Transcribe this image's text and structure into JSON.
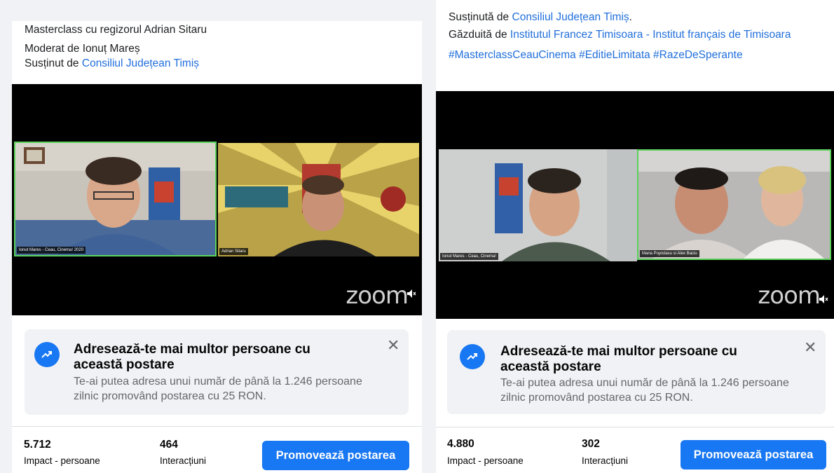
{
  "left": {
    "title_line": "Masterclass cu regizorul Adrian Sitaru",
    "moderated_prefix": "Moderat de",
    "moderator": "Ionuț Mareș",
    "supported_prefix": "Susținut de",
    "supporter_link": "Consiliul Județean Timiș",
    "tiles": [
      {
        "name": "Ionut Mares - Ceau, Cinema! 2020"
      },
      {
        "name": "Adrian Sitaru"
      }
    ],
    "zoom": "zoom",
    "boost": {
      "title": "Adresează-te mai multor persoane cu această postare",
      "subtitle": "Te-ai putea adresa unui număr de până la 1.246 persoane zilnic promovând postarea cu 25 RON.",
      "close": "✕"
    },
    "stats": [
      {
        "value": "5.712",
        "label": "Impact - persoane"
      },
      {
        "value": "464",
        "label": "Interacțiuni"
      }
    ],
    "promote_label": "Promovează postarea"
  },
  "right": {
    "supported_prefix": "Susținută de",
    "supporter_link": "Consiliul Județean Timiș",
    "supporter_suffix": ".",
    "hosted_prefix": "Găzduită de",
    "host_link": "Institutul Francez Timisoara - Institut français de Timisoara",
    "hashtags": "#MasterclassCeauCinema #EditieLimitata #RazeDeSperante",
    "tiles": [
      {
        "name": "Ionut Mares - Ceau, Cinema!"
      },
      {
        "name": "Maria Popistasu si Alex Baciu"
      }
    ],
    "zoom": "zoom",
    "boost": {
      "title": "Adresează-te mai multor persoane cu această postare",
      "subtitle": "Te-ai putea adresa unui număr de până la 1.246 persoane zilnic promovând postarea cu 25 RON.",
      "close": "✕"
    },
    "stats": [
      {
        "value": "4.880",
        "label": "Impact - persoane"
      },
      {
        "value": "302",
        "label": "Interacțiuni"
      }
    ],
    "promote_label": "Promovează postarea"
  },
  "colors": {
    "accent": "#1877f2",
    "link": "#216fdb",
    "active_tile": "#5bd35b"
  }
}
